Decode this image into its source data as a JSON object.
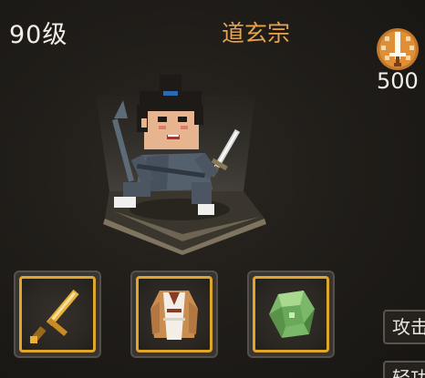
{
  "player": {
    "level": "90级",
    "sect": "道玄宗"
  },
  "currency": {
    "icon": "sword-coin-icon",
    "value": "500"
  },
  "equipment": [
    {
      "slot": "weapon",
      "icon": "golden-sword-icon"
    },
    {
      "slot": "armor",
      "icon": "robe-icon"
    },
    {
      "slot": "accessory",
      "icon": "jade-stone-icon"
    }
  ],
  "tabs": {
    "attack": "攻击",
    "light": "轻功"
  },
  "colors": {
    "sect_text": "#e7a34b",
    "slot_border": "#e0a62b",
    "background": "#1c1916"
  }
}
